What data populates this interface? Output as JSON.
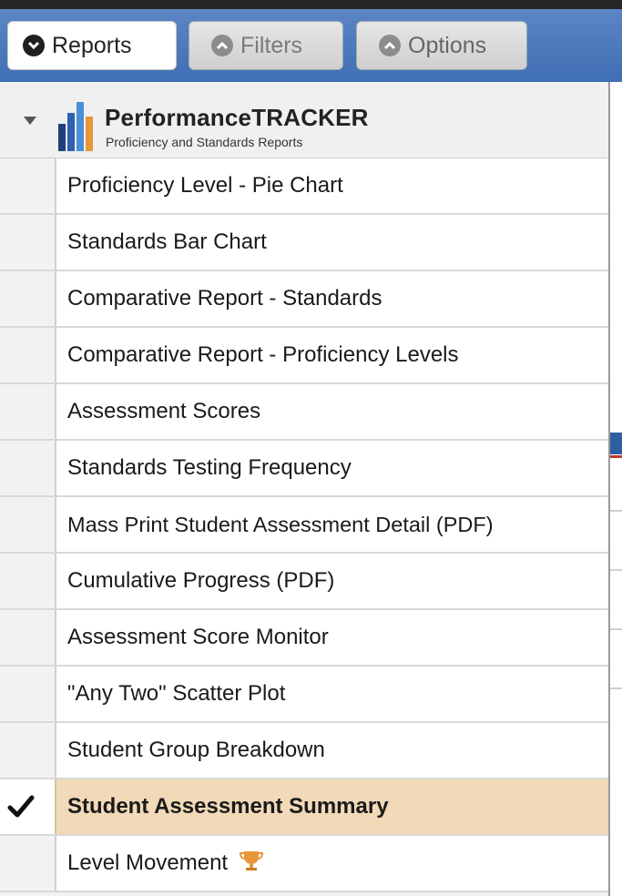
{
  "toolbar": {
    "reports_label": "Reports",
    "filters_label": "Filters",
    "options_label": "Options"
  },
  "header": {
    "brand": "PerformanceTRACKER",
    "subtitle": "Proficiency and Standards Reports"
  },
  "menu": {
    "items": [
      {
        "label": "Proficiency Level - Pie Chart"
      },
      {
        "label": "Standards Bar Chart"
      },
      {
        "label": "Comparative Report - Standards"
      },
      {
        "label": "Comparative Report - Proficiency Levels"
      },
      {
        "label": "Assessment Scores"
      },
      {
        "label": "Standards Testing Frequency"
      },
      {
        "label": "Mass Print Student Assessment Detail (PDF)"
      },
      {
        "label": "Cumulative Progress (PDF)"
      },
      {
        "label": "Assessment Score Monitor"
      },
      {
        "label": "\"Any Two\" Scatter Plot"
      },
      {
        "label": "Student Group Breakdown"
      },
      {
        "label": "Student Assessment Summary"
      },
      {
        "label": "Level Movement"
      }
    ],
    "selected": "Student Assessment Summary"
  },
  "colors": {
    "toolbar": "#4a78bb",
    "selected_row": "#f2d9b8",
    "trophy": "#e8963a"
  },
  "icons": {
    "selected_marker": "checkmark-icon",
    "level_movement_badge": "trophy-icon"
  }
}
